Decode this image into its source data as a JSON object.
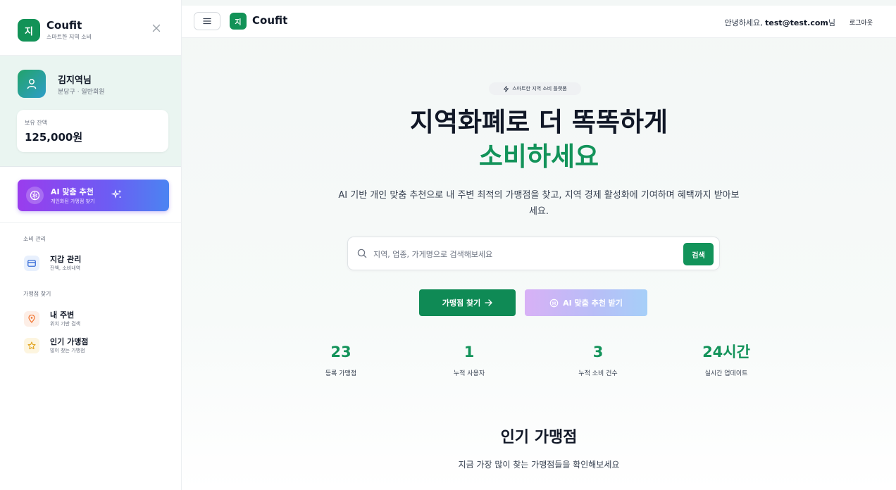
{
  "sidebar": {
    "logo_char": "지",
    "brand": "Coufit",
    "tagline": "스마트한 지역 소비",
    "profile": {
      "name": "김지역님",
      "meta": "분당구 · 일반회원"
    },
    "balance": {
      "label": "보유 잔액",
      "value": "125,000원"
    },
    "ai_card": {
      "title": "AI 맞춤 추천",
      "subtitle": "개인화된 가맹점 찾기"
    },
    "sections": [
      {
        "label": "소비 관리",
        "items": [
          {
            "title": "지갑 관리",
            "subtitle": "잔액, 소비내역",
            "icon": "wallet-icon"
          }
        ]
      },
      {
        "label": "가맹점 찾기",
        "items": [
          {
            "title": "내 주변",
            "subtitle": "위치 기반 검색",
            "icon": "location-pin-icon"
          },
          {
            "title": "인기 가맹점",
            "subtitle": "많이 찾는 가맹점",
            "icon": "star-icon"
          }
        ]
      }
    ]
  },
  "header": {
    "logo_char": "지",
    "brand": "Coufit",
    "greeting_prefix": "안녕하세요, ",
    "user_email": "test@test.com",
    "greeting_suffix": "님",
    "logout_label": "로그아웃"
  },
  "hero": {
    "badge": "스마트한 지역 소비 플랫폼",
    "title_line1": "지역화폐로 더 똑똑하게",
    "title_line2": "소비하세요",
    "description": "AI 기반 개인 맞춤 추천으로 내 주변 최적의 가맹점을 찾고, 지역 경제 활성화에 기여하며 혜택까지 받아보세요.",
    "search_placeholder": "지역, 업종, 가게명으로 검색해보세요",
    "search_button": "검색",
    "cta_primary": "가맹점 찾기",
    "cta_ai": "AI 맞춤 추천 받기"
  },
  "stats": [
    {
      "value": "23",
      "label": "등록 가맹점"
    },
    {
      "value": "1",
      "label": "누적 사용자"
    },
    {
      "value": "3",
      "label": "누적 소비 건수"
    },
    {
      "value": "24시간",
      "label": "실시간 업데이트"
    }
  ],
  "popular": {
    "title": "인기 가맹점",
    "subtitle": "지금 가장 많이 찾는 가맹점들을 확인해보세요"
  },
  "colors": {
    "brand_green": "#12935a",
    "ai_purple": "#9a3ded",
    "ai_blue": "#4b84f2"
  }
}
